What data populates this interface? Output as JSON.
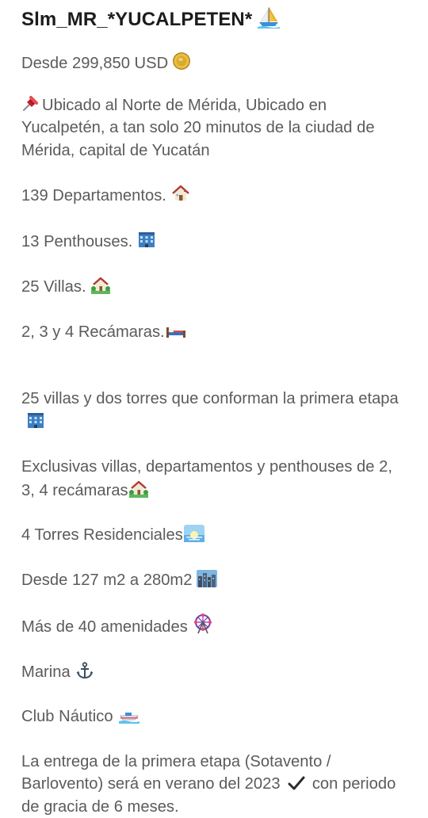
{
  "post": {
    "title": "Slm_MR_*YUCALPETEN*",
    "title_icon": "sailboat-icon",
    "paragraphs": [
      {
        "text": "Desde 299,850 USD",
        "icon": "coin-icon"
      },
      {
        "text": "Ubicado al Norte de Mérida, Ubicado en Yucalpetén, a tan solo 20 minutos de la ciudad de Mérida, capital de Yucatán",
        "icon": "pushpin-icon"
      },
      {
        "text": "139 Departamentos.",
        "icon": "house-icon"
      },
      {
        "text": "13 Penthouses.",
        "icon": "office-building-icon"
      },
      {
        "text": "25 Villas.",
        "icon": "house-with-garden-icon"
      },
      {
        "text": "2, 3 y 4 Recámaras.",
        "icon": "bed-icon"
      },
      {
        "text": "25 villas y dos torres que conforman la primera etapa",
        "icon": "office-building-icon"
      },
      {
        "text": "Exclusivas villas, departamentos y penthouses de 2, 3, 4 recámaras",
        "icon": "house-with-garden-icon"
      },
      {
        "text": "4 Torres Residenciales",
        "icon": "sunrise-icon"
      },
      {
        "text": "Desde 127 m2 a 280m2",
        "icon": "cityscape-icon"
      },
      {
        "text": "Más de 40 amenidades",
        "icon": "ferris-wheel-icon"
      },
      {
        "text": "Marina",
        "icon": "anchor-icon"
      },
      {
        "text": "Club Náutico",
        "icon": "speedboat-icon"
      },
      {
        "text": "La entrega de la primera etapa (Sotavento / Barlovento) será en verano del 2023",
        "tail_icon": "check-mark-icon",
        "tail": "con periodo de gracia de 6 meses."
      }
    ]
  }
}
